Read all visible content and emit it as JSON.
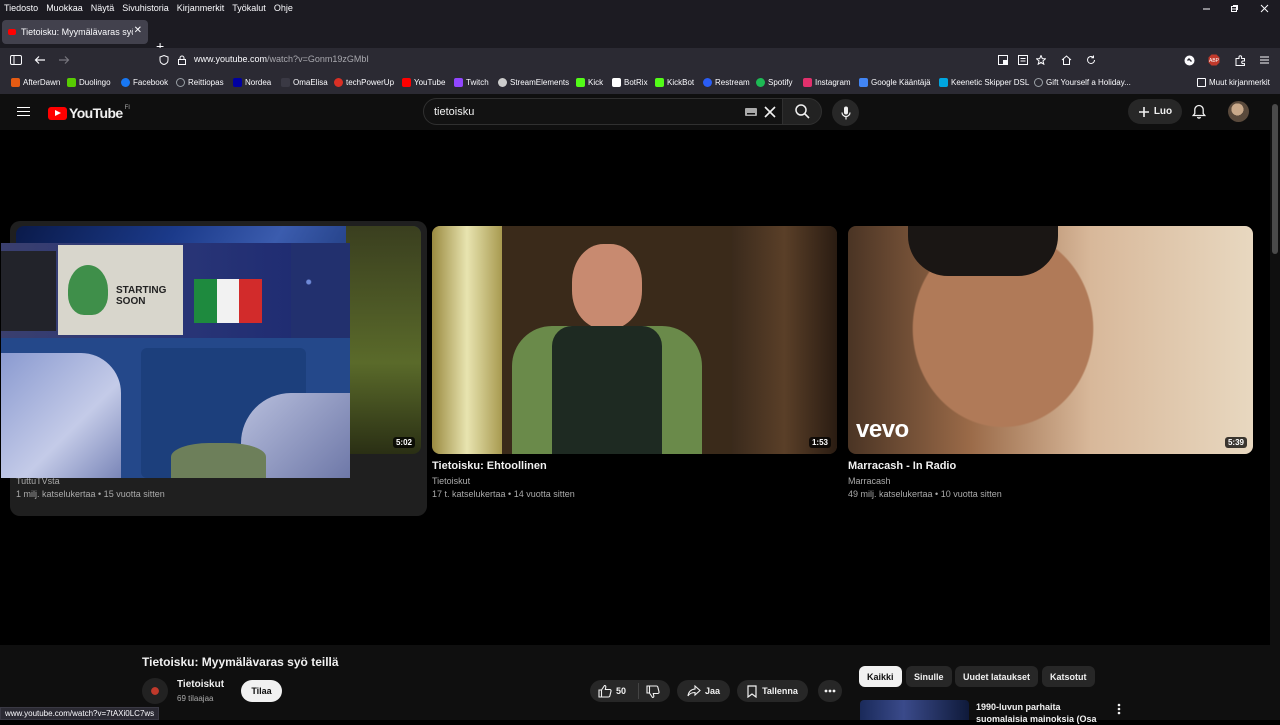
{
  "menubar": {
    "items": [
      "Tiedosto",
      "Muokkaa",
      "Näytä",
      "Sivuhistoria",
      "Kirjanmerkit",
      "Työkalut",
      "Ohje"
    ]
  },
  "tab": {
    "title": "Tietoisku: Myymälävaras syö teillä"
  },
  "address": {
    "url_host": "www.youtube.com",
    "url_path": "/watch?v=Gonm19zGMbI"
  },
  "bookmarks": [
    {
      "label": "AfterDawn",
      "color": "#e55b13"
    },
    {
      "label": "Duolingo",
      "color": "#58cc02"
    },
    {
      "label": "Facebook",
      "color": "#1877f2"
    },
    {
      "label": "Reittiopas",
      "color": "#9aa0a6"
    },
    {
      "label": "Nordea",
      "color": "#0000a0"
    },
    {
      "label": "OmaElisa",
      "color": "#2b2a33"
    },
    {
      "label": "techPowerUp",
      "color": "#d93025"
    },
    {
      "label": "YouTube",
      "color": "#ff0000"
    },
    {
      "label": "Twitch",
      "color": "#9146ff"
    },
    {
      "label": "StreamElements",
      "color": "#cccccc"
    },
    {
      "label": "Kick",
      "color": "#53fc18"
    },
    {
      "label": "BotRix",
      "color": "#ffffff"
    },
    {
      "label": "KickBot",
      "color": "#53fc18"
    },
    {
      "label": "Restream",
      "color": "#2a5df5"
    },
    {
      "label": "Spotify",
      "color": "#1db954"
    },
    {
      "label": "Instagram",
      "color": "#e1306c"
    },
    {
      "label": "Google Kääntäjä",
      "color": "#4285f4"
    },
    {
      "label": "Keenetic Skipper DSL",
      "color": "#00a6e0"
    },
    {
      "label": "Gift Yourself a Holiday...",
      "color": "#9aa0a6"
    }
  ],
  "other_bookmarks": "Muut kirjanmerkit",
  "youtube": {
    "logo_text": "YouTube",
    "region": "FI",
    "search_value": "tietoisku",
    "create_label": "Luo"
  },
  "videos": [
    {
      "title": "",
      "channel": "TuttuTVsta",
      "meta": "1 milj. katselukertaa • 15 vuotta sitten",
      "duration": "5:02"
    },
    {
      "title": "Tietoisku: Ehtoollinen",
      "channel": "Tietoiskut",
      "meta": "17 t. katselukertaa • 14 vuotta sitten",
      "duration": "1:53"
    },
    {
      "title": "Marracash - In Radio",
      "channel": "Marracash",
      "meta": "49 milj. katselukertaa • 10 vuotta sitten",
      "duration": "5:39",
      "badge": "vevo"
    }
  ],
  "overlay_sign": "STARTING SOON",
  "watch": {
    "title": "Tietoisku: Myymälävaras syö teillä",
    "channel": "Tietoiskut",
    "subscribers": "69 tilaajaa",
    "subscribe_label": "Tilaa",
    "likes": "50",
    "share_label": "Jaa",
    "save_label": "Tallenna"
  },
  "chips": [
    "Kaikki",
    "Sinulle",
    "Uudet lataukset",
    "Katsotut"
  ],
  "side_video": {
    "title": "1990-luvun parhaita suomalaisia mainoksia (Osa"
  },
  "status_url": "www.youtube.com/watch?v=7tAXi0LC7ws"
}
